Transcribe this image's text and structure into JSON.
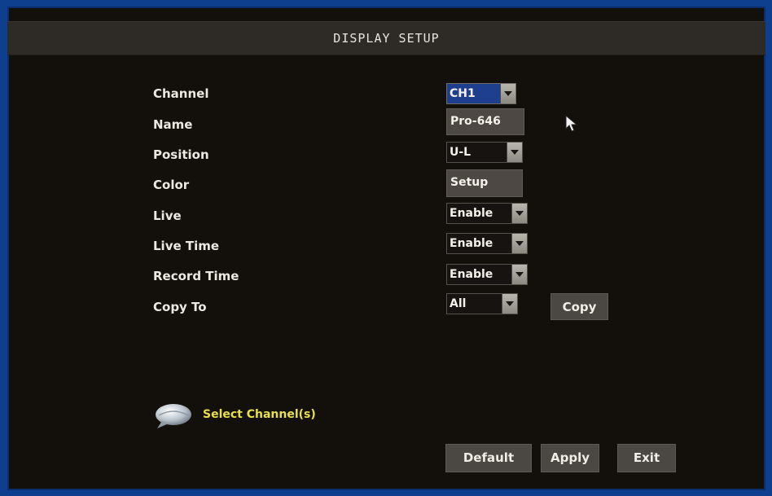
{
  "title": "DISPLAY SETUP",
  "rows": [
    {
      "label": "Channel",
      "value": "CH1"
    },
    {
      "label": "Name",
      "value": "Pro-646"
    },
    {
      "label": "Position",
      "value": "U-L"
    },
    {
      "label": "Color",
      "value": "Setup"
    },
    {
      "label": "Live",
      "value": "Enable"
    },
    {
      "label": "Live Time",
      "value": "Enable"
    },
    {
      "label": "Record Time",
      "value": "Enable"
    },
    {
      "label": "Copy To",
      "value": "All"
    }
  ],
  "copy_button": "Copy",
  "hint": {
    "text": "Select Channel(s)",
    "icon": "speech-bubble-icon"
  },
  "footer": {
    "default": "Default",
    "apply": "Apply",
    "exit": "Exit"
  },
  "colors": {
    "frame": "#0d3f8e",
    "background": "#130f0b",
    "selected": "#1e3f8d",
    "hint": "#e7e04a"
  }
}
